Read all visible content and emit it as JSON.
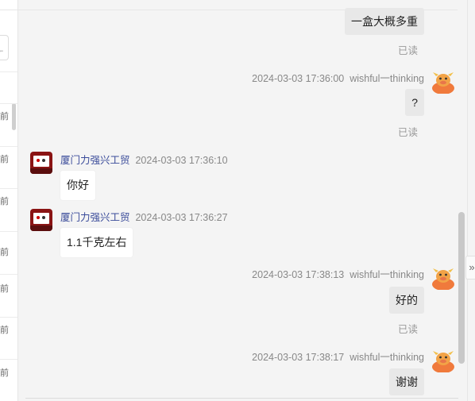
{
  "sidebar": {
    "time_suffixes": [
      "前",
      "前",
      "前",
      "前",
      "前",
      "前",
      "前"
    ]
  },
  "chat": {
    "messages": [
      {
        "side": "right",
        "text": "一盒大概多重",
        "read_status": "已读"
      },
      {
        "side": "right",
        "timestamp": "2024-03-03 17:36:00",
        "sender": "wishful一thinking",
        "text": "?",
        "read_status": "已读",
        "avatar": "cartoon-bull-avatar"
      },
      {
        "side": "left",
        "sender": "厦门力强兴工贸",
        "timestamp": "2024-03-03 17:36:10",
        "text": "你好",
        "avatar": "shop-logo-avatar"
      },
      {
        "side": "left",
        "sender": "厦门力强兴工贸",
        "timestamp": "2024-03-03 17:36:27",
        "text": "1.1千克左右",
        "avatar": "shop-logo-avatar"
      },
      {
        "side": "right",
        "timestamp": "2024-03-03 17:38:13",
        "sender": "wishful一thinking",
        "text": "好的",
        "read_status": "已读",
        "avatar": "cartoon-bull-avatar"
      },
      {
        "side": "right",
        "timestamp": "2024-03-03 17:38:17",
        "sender": "wishful一thinking",
        "text": "谢谢",
        "avatar": "cartoon-bull-avatar"
      }
    ]
  },
  "expand_icon": "»",
  "colors": {
    "bubble_right": "#e8e8e8",
    "bubble_left": "#ffffff",
    "seller_name": "#3a4b9a",
    "avatar_orange": "#f07a3c"
  }
}
